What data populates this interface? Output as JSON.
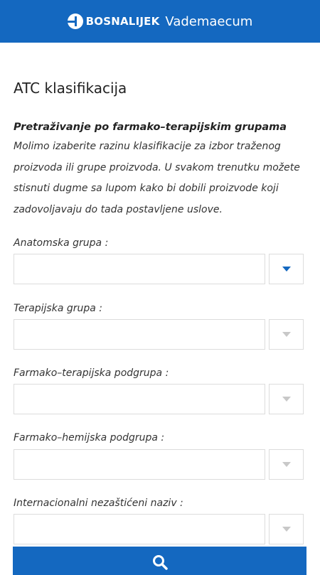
{
  "header": {
    "brand_name": "BOSNALIJEK",
    "brand_sub": "Vademaecum",
    "bg_color": "#1468c0"
  },
  "page": {
    "title": "ATC klasifikacija",
    "intro_heading": "Pretraživanje po farmako–terapijskim grupama",
    "intro_text": "Molimo izaberite razinu klasifikacije za izbor traženog proizvoda ili grupe proizvoda. U svakom trenutku možete stisnuti dugme sa lupom kako bi dobili proizvode koji zadovoljavaju do tada postavljene uslove."
  },
  "fields": [
    {
      "label": "Anatomska grupa :",
      "value": "",
      "enabled": true
    },
    {
      "label": "Terapijska grupa :",
      "value": "",
      "enabled": false
    },
    {
      "label": "Farmako–terapijska podgrupa :",
      "value": "",
      "enabled": false
    },
    {
      "label": "Farmako–hemijska podgrupa :",
      "value": "",
      "enabled": false
    },
    {
      "label": "Internacionalni nezaštićeni naziv :",
      "value": "",
      "enabled": false
    }
  ],
  "search_button": {
    "icon": "search-icon",
    "color": "#1468c0"
  }
}
